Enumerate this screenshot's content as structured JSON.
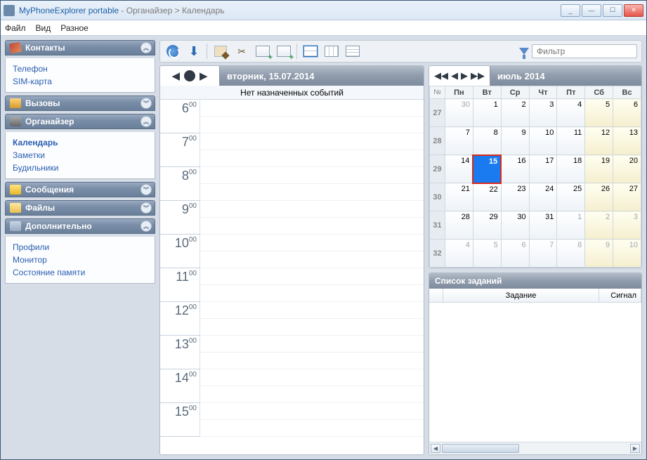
{
  "title": {
    "app": "MyPhoneExplorer portable",
    "sep": " -  ",
    "path": "Органайзер > Календарь"
  },
  "menu": [
    "Файл",
    "Вид",
    "Разное"
  ],
  "sidebar": [
    {
      "label": "Контакты",
      "items": [
        "Телефон",
        "SIM-карта"
      ],
      "expanded": true,
      "icon": "ic-contacts"
    },
    {
      "label": "Вызовы",
      "items": [],
      "expanded": false,
      "icon": "ic-calls"
    },
    {
      "label": "Органайзер",
      "items": [
        "Календарь",
        "Заметки",
        "Будильники"
      ],
      "expanded": true,
      "active": "Календарь",
      "icon": "ic-org"
    },
    {
      "label": "Сообщения",
      "items": [],
      "expanded": false,
      "icon": "ic-msg"
    },
    {
      "label": "Файлы",
      "items": [],
      "expanded": false,
      "icon": "ic-files"
    },
    {
      "label": "Дополнительно",
      "items": [
        "Профили",
        "Монитор",
        "Состояние памяти"
      ],
      "expanded": true,
      "icon": "ic-extra"
    }
  ],
  "filter_placeholder": "Фильтр",
  "day": {
    "header": "вторник, 15.07.2014",
    "no_events": "Нет назначенных событий",
    "hours": [
      6,
      7,
      8,
      9,
      10,
      11,
      12,
      13,
      14,
      15
    ],
    "minutes_label": "00"
  },
  "month": {
    "header": "июль 2014",
    "week_col": "№",
    "days": [
      "Пн",
      "Вт",
      "Ср",
      "Чт",
      "Пт",
      "Сб",
      "Вс"
    ],
    "rows": [
      {
        "wk": 27,
        "d": [
          {
            "n": 30,
            "o": true
          },
          {
            "n": 1
          },
          {
            "n": 2
          },
          {
            "n": 3
          },
          {
            "n": 4
          },
          {
            "n": 5,
            "we": true
          },
          {
            "n": 6,
            "we": true
          }
        ]
      },
      {
        "wk": 28,
        "d": [
          {
            "n": 7
          },
          {
            "n": 8
          },
          {
            "n": 9
          },
          {
            "n": 10
          },
          {
            "n": 11
          },
          {
            "n": 12,
            "we": true
          },
          {
            "n": 13,
            "we": true
          }
        ]
      },
      {
        "wk": 29,
        "d": [
          {
            "n": 14
          },
          {
            "n": 15,
            "today": true
          },
          {
            "n": 16
          },
          {
            "n": 17
          },
          {
            "n": 18
          },
          {
            "n": 19,
            "we": true
          },
          {
            "n": 20,
            "we": true
          }
        ]
      },
      {
        "wk": 30,
        "d": [
          {
            "n": 21
          },
          {
            "n": 22
          },
          {
            "n": 23
          },
          {
            "n": 24
          },
          {
            "n": 25
          },
          {
            "n": 26,
            "we": true
          },
          {
            "n": 27,
            "we": true
          }
        ]
      },
      {
        "wk": 31,
        "d": [
          {
            "n": 28
          },
          {
            "n": 29
          },
          {
            "n": 30
          },
          {
            "n": 31
          },
          {
            "n": 1,
            "o": true
          },
          {
            "n": 2,
            "o": true,
            "we": true
          },
          {
            "n": 3,
            "o": true,
            "we": true
          }
        ]
      },
      {
        "wk": 32,
        "d": [
          {
            "n": 4,
            "o": true
          },
          {
            "n": 5,
            "o": true
          },
          {
            "n": 6,
            "o": true
          },
          {
            "n": 7,
            "o": true
          },
          {
            "n": 8,
            "o": true
          },
          {
            "n": 9,
            "o": true,
            "we": true
          },
          {
            "n": 10,
            "o": true,
            "we": true
          }
        ]
      }
    ]
  },
  "tasks": {
    "header": "Список заданий",
    "cols": {
      "task": "Задание",
      "signal": "Сигнал"
    }
  }
}
